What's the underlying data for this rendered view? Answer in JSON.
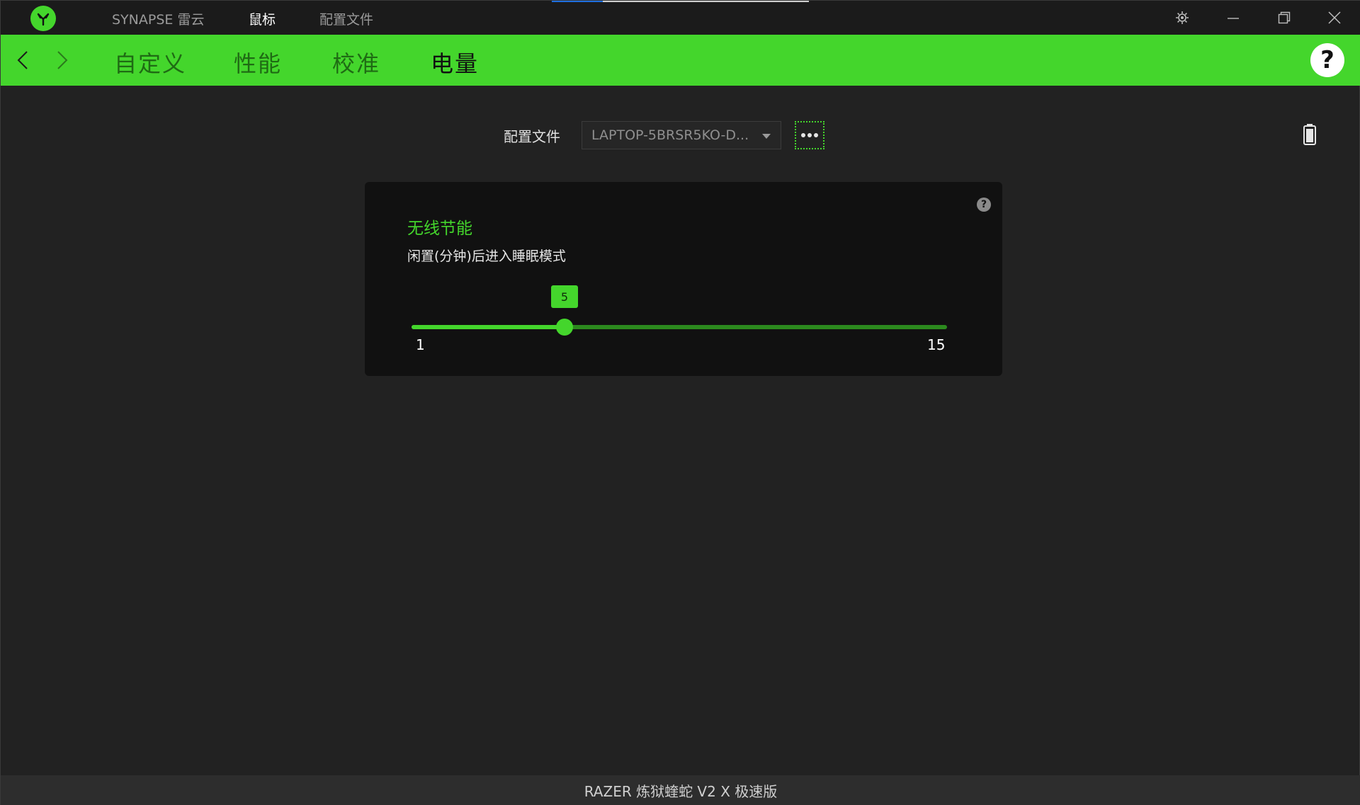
{
  "titlebar": {
    "app_name": "SYNAPSE 雷云",
    "tabs": [
      {
        "label": "鼠标",
        "active": true
      },
      {
        "label": "配置文件",
        "active": false
      }
    ],
    "icons": {
      "logo": "razer-logo-icon",
      "settings": "gear-icon",
      "minimize": "minimize-icon",
      "restore": "restore-icon",
      "close": "close-icon"
    }
  },
  "nav": {
    "tabs": [
      {
        "label": "自定义",
        "active": false
      },
      {
        "label": "性能",
        "active": false
      },
      {
        "label": "校准",
        "active": false
      },
      {
        "label": "电量",
        "active": true
      }
    ],
    "help_label": "?"
  },
  "profile": {
    "label": "配置文件",
    "selected": "LAPTOP-5BRSR5KO-D..."
  },
  "card": {
    "title": "无线节能",
    "subtitle": "闲置(分钟)后进入睡眠模式",
    "help_label": "?",
    "slider": {
      "min": 1,
      "max": 15,
      "value": 5,
      "min_label": "1",
      "max_label": "15",
      "value_label": "5"
    }
  },
  "footer": {
    "device_name": "RAZER 炼狱蝰蛇 V2 X 极速版"
  },
  "colors": {
    "accent": "#44d62c",
    "background": "#222222",
    "card": "#111111",
    "titlebar": "#1b1b1b"
  }
}
